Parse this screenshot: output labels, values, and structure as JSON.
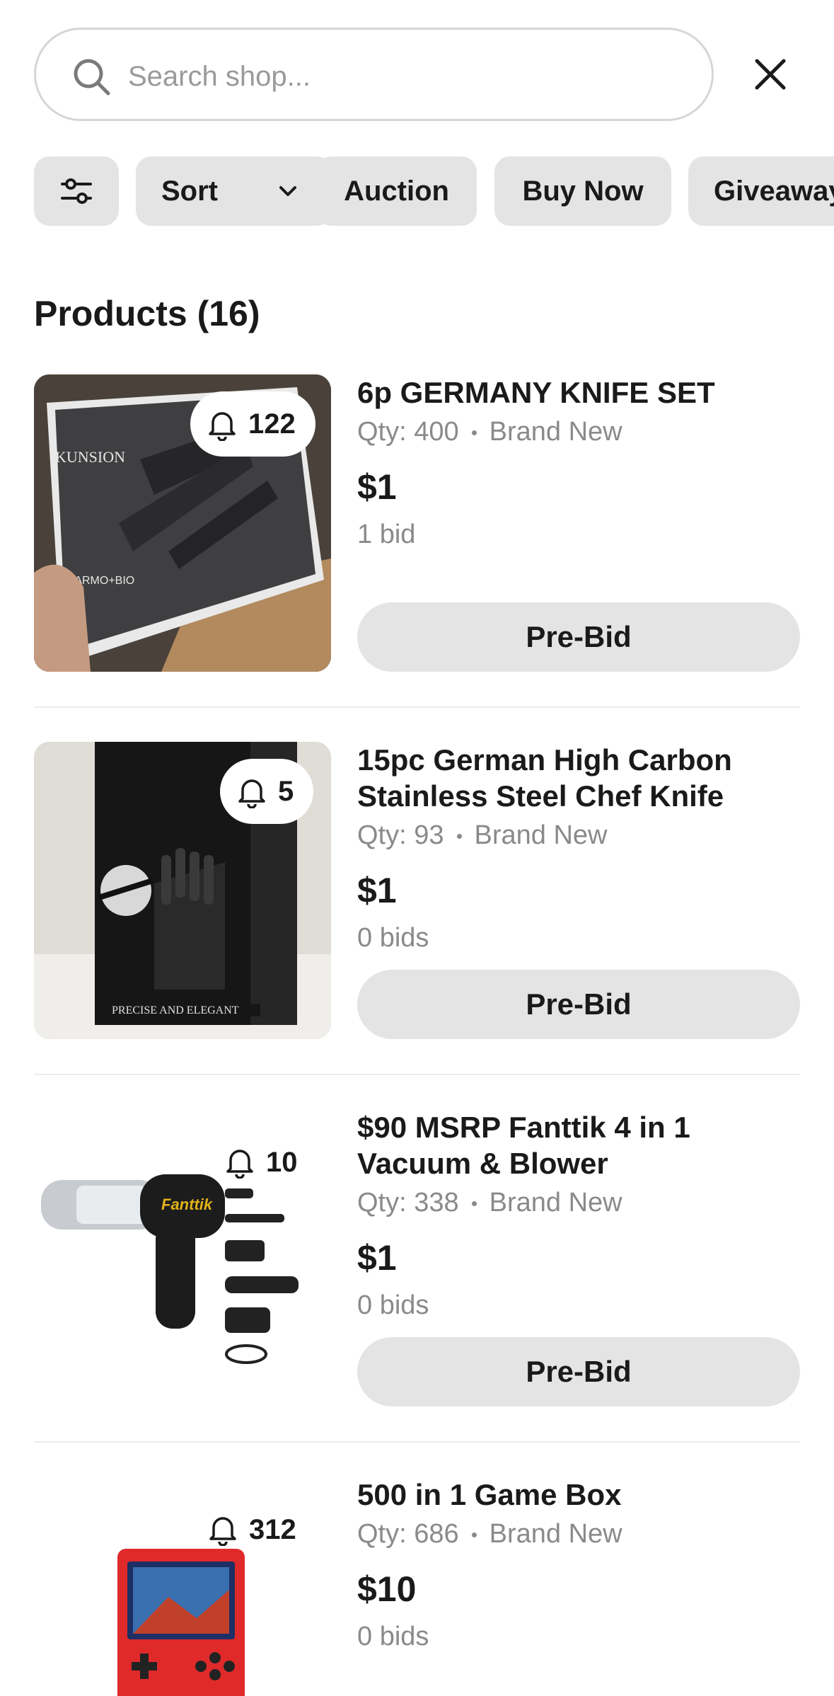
{
  "search": {
    "placeholder": "Search shop..."
  },
  "chips": {
    "sort": "Sort",
    "auction": "Auction",
    "buy_now": "Buy Now",
    "giveaway": "Giveaway"
  },
  "section": {
    "title": "Products (16)"
  },
  "products": [
    {
      "title": "6p GERMANY KNIFE SET",
      "qty": "Qty: 400",
      "condition": "Brand New",
      "price": "$1",
      "bids": "1 bid",
      "watchers": "122",
      "button": "Pre-Bid",
      "image_text_brand": "KUNSION",
      "image_text_sub": "MARMO+BIO"
    },
    {
      "title": "15pc German High Carbon Stainless Steel Chef Knife",
      "qty": "Qty: 93",
      "condition": "Brand New",
      "price": "$1",
      "bids": "0 bids",
      "watchers": "5",
      "button": "Pre-Bid",
      "image_text_box": "PRECISE AND ELEGANT"
    },
    {
      "title": "$90 MSRP Fanttik 4 in 1 Vacuum & Blower",
      "qty": "Qty: 338",
      "condition": "Brand New",
      "price": "$1",
      "bids": "0 bids",
      "watchers": "10",
      "button": "Pre-Bid",
      "image_text_brand": "Fanttik"
    },
    {
      "title": "500 in 1 Game Box",
      "qty": "Qty: 686",
      "condition": "Brand New",
      "price": "$10",
      "bids": "0 bids",
      "watchers": "312"
    }
  ],
  "icons": [
    "search-icon",
    "close-icon",
    "filter-icon",
    "chevron-down-icon",
    "bell-icon"
  ],
  "colors": {
    "chip_bg": "#e4e4e4",
    "muted_text": "#8a8a8a",
    "text": "#1a1a1a",
    "border": "#d6d6d6"
  }
}
